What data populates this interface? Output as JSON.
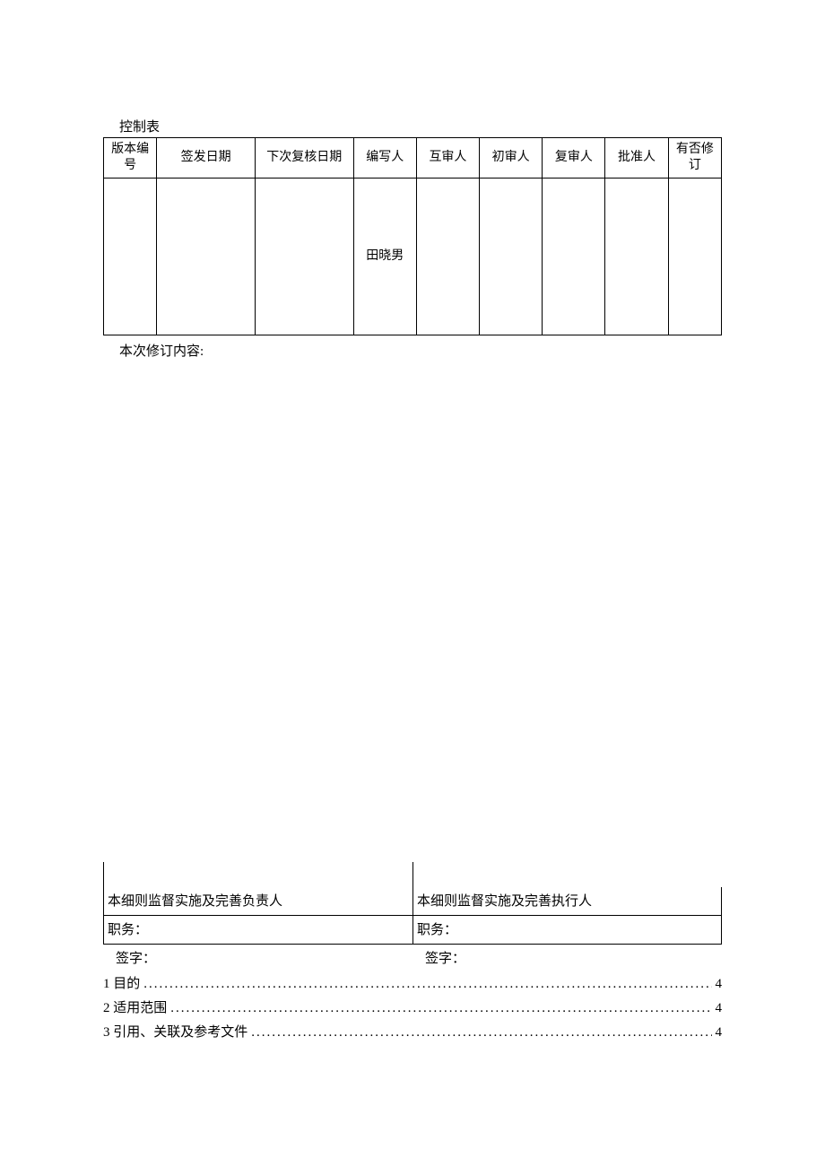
{
  "labels": {
    "control_table": "控制表",
    "revision_content": "本次修订内容:"
  },
  "control_table": {
    "headers": {
      "version_no": "版本编号",
      "issue_date": "签发日期",
      "next_review_date": "下次复核日期",
      "writer": "编写人",
      "mutual_reviewer": "互审人",
      "initial_reviewer": "初审人",
      "re_reviewer": "复审人",
      "approver": "批准人",
      "has_revision": "有否修订"
    },
    "row": {
      "version_no": "",
      "issue_date": "",
      "next_review_date": "",
      "writer": "田晓男",
      "mutual_reviewer": "",
      "initial_reviewer": "",
      "re_reviewer": "",
      "approver": "",
      "has_revision": ""
    }
  },
  "signature": {
    "left": {
      "title": "本细则监督实施及完善负责人",
      "role_label": "职务：",
      "sign_label": "签字："
    },
    "right": {
      "title": "本细则监督实施及完善执行人",
      "role_label": "职务：",
      "sign_label": "签字："
    }
  },
  "toc": [
    {
      "label": "1 目的",
      "page": "4"
    },
    {
      "label": "2 适用范围",
      "page": "4"
    },
    {
      "label": "3 引用、关联及参考文件",
      "page": "4"
    }
  ]
}
